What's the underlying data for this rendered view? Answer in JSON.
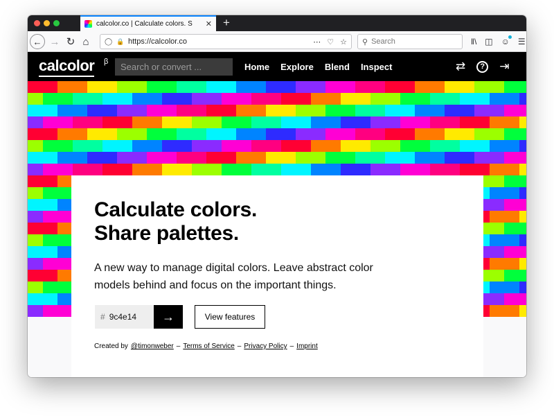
{
  "browser": {
    "tab_title": "calcolor.co | Calculate colors. S",
    "tab_close": "✕",
    "new_tab": "+",
    "url": "https://calcolor.co",
    "search_placeholder": "Search"
  },
  "site": {
    "logo": "calcolor",
    "logo_beta": "β",
    "search_placeholder": "Search or convert ...",
    "nav": [
      {
        "label": "Home",
        "active": true
      },
      {
        "label": "Explore",
        "active": false
      },
      {
        "label": "Blend",
        "active": false
      },
      {
        "label": "Inspect",
        "active": false
      }
    ],
    "icons": [
      "shuffle-icon",
      "help-icon",
      "sign-in-icon"
    ]
  },
  "hero": {
    "headline_line1": "Calculate colors.",
    "headline_line2": "Share palettes.",
    "subtext": "A new way to manage digital colors. Leave abstract color models behind and focus on the important things.",
    "hex_prefix": "#",
    "hex_value": "9c4e14",
    "view_features": "View features",
    "footer": {
      "created_by": "Created by",
      "author": "@timonweber",
      "sep": "–",
      "terms": "Terms of Service",
      "privacy": "Privacy Policy",
      "imprint": "Imprint"
    }
  },
  "grid_palette": [
    "#ff0033",
    "#ff7a00",
    "#ffea00",
    "#9cff00",
    "#00ff3c",
    "#00ffa0",
    "#00f5ff",
    "#0084ff",
    "#2e2bff",
    "#8a2bff",
    "#ff00d4",
    "#ff0080"
  ]
}
